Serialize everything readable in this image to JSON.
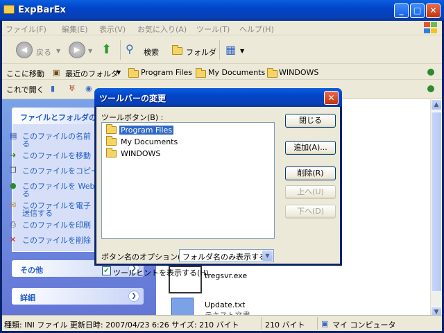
{
  "window": {
    "title": "ExpBarEx",
    "controls": {
      "minimize": "_",
      "maximize": "□",
      "close": "✕"
    }
  },
  "menubar": {
    "items": [
      "ファイル(F)",
      "編集(E)",
      "表示(V)",
      "お気に入り(A)",
      "ツール(T)",
      "ヘルプ(H)"
    ]
  },
  "toolbar": {
    "back": "戻る",
    "search": "検索",
    "folders": "フォルダ"
  },
  "linkbar1": {
    "label": "ここに移動",
    "items": [
      "最近のフォルダ",
      "Program Files",
      "My Documents",
      "WINDOWS"
    ]
  },
  "linkbar2": {
    "label": "これで開く"
  },
  "taskpane": {
    "file_tasks_header": "ファイルとフォルダのタ",
    "tasks": [
      "このファイルの名前",
      "る",
      "このファイルを移動",
      "このファイルをコピー",
      "このファイルを Web",
      "る",
      "このファイルを電子",
      "送信する",
      "このファイルを印刷",
      "このファイルを削除"
    ],
    "other_header": "その他",
    "details_header": "詳細"
  },
  "files": [
    {
      "name": "tregsvr.exe",
      "sub": ""
    },
    {
      "name": "Update.txt",
      "sub": "テキスト文書"
    }
  ],
  "statusbar": {
    "info": "種類: INI ファイル 更新日時: 2007/04/23 6:26 サイズ: 210 バイト",
    "size": "210 バイト",
    "location": "マイ コンピュータ"
  },
  "dialog": {
    "title": "ツールバーの変更",
    "list_label": "ツールボタン(B) :",
    "list_items": [
      "Program Files",
      "My Documents",
      "WINDOWS"
    ],
    "selected_index": 0,
    "buttons": {
      "close": "閉じる",
      "add": "追加(A)...",
      "delete": "削除(R)",
      "up": "上へ(U)",
      "down": "下へ(D)"
    },
    "name_option_label": "ボタン名のオプション(C) :",
    "name_option_value": "フォルダ名のみ表示する",
    "tooltip_label": "ツールヒントを表示する(H)",
    "tooltip_checked": true
  }
}
